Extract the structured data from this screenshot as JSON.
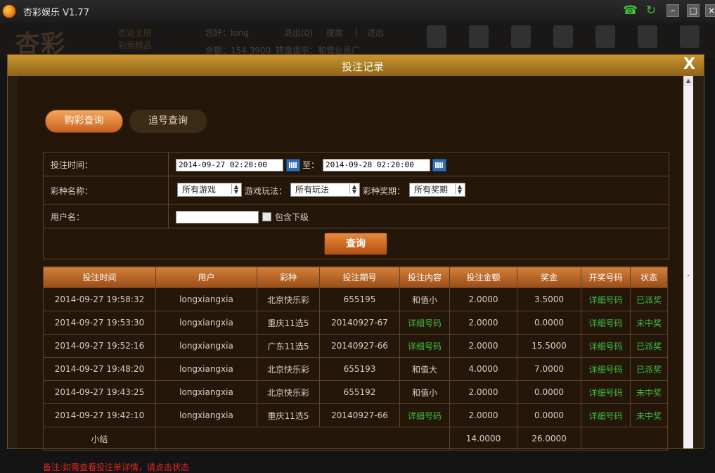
{
  "app": {
    "title": "杏彩娱乐 V1.77",
    "background_header": {
      "logo_text": "杏彩",
      "slogan_line1": "杏运无限",
      "slogan_line2": "彩票精品",
      "greeting": "您好：long",
      "links": [
        "退出(0)",
        "提款",
        "|",
        "退出"
      ],
      "balance": "余额：154.3900",
      "notice": "转盘提示：和营业员厂"
    }
  },
  "modal": {
    "title": "投注记录",
    "close_label": "X",
    "tabs": [
      "购彩查询",
      "追号查询"
    ],
    "form": {
      "time_label": "投注时间：",
      "start_time": "2014-09-27 02:20:00",
      "to_label": "至：",
      "end_time": "2014-09-28 02:20:00",
      "lottery_label": "彩种名称：",
      "lottery_value": "所有游戏",
      "play_label": "游戏玩法：",
      "play_value": "所有玩法",
      "period_label": "彩种奖期：",
      "period_value": "所有奖期",
      "user_label": "用户名：",
      "user_value": "",
      "include_sub_label": "包含下级",
      "query_button": "查询"
    },
    "table": {
      "headers": [
        "投注时间",
        "用户",
        "彩种",
        "投注期号",
        "投注内容",
        "投注金额",
        "奖金",
        "开奖号码",
        "状态"
      ],
      "rows": [
        [
          "2014-09-27 19:58:32",
          "longxiangxia",
          "北京快乐彩",
          "655195",
          "和值小",
          "2.0000",
          "3.5000",
          "详细号码",
          "已派奖"
        ],
        [
          "2014-09-27 19:53:30",
          "longxiangxia",
          "重庆11选5",
          "20140927-67",
          "详细号码",
          "2.0000",
          "0.0000",
          "详细号码",
          "未中奖"
        ],
        [
          "2014-09-27 19:52:16",
          "longxiangxia",
          "广东11选5",
          "20140927-66",
          "详细号码",
          "2.0000",
          "15.5000",
          "详细号码",
          "已派奖"
        ],
        [
          "2014-09-27 19:48:20",
          "longxiangxia",
          "北京快乐彩",
          "655193",
          "和值大",
          "4.0000",
          "7.0000",
          "详细号码",
          "已派奖"
        ],
        [
          "2014-09-27 19:43:25",
          "longxiangxia",
          "北京快乐彩",
          "655192",
          "和值小",
          "2.0000",
          "0.0000",
          "详细号码",
          "未中奖"
        ],
        [
          "2014-09-27 19:42:10",
          "longxiangxia",
          "重庆11选5",
          "20140927-66",
          "详细号码",
          "2.0000",
          "0.0000",
          "详细号码",
          "未中奖"
        ]
      ],
      "subtotal_label": "小结",
      "subtotal_amount": "14.0000",
      "subtotal_prize": "26.0000"
    },
    "remark": "备注:如需查看投注单详情，请点击状态"
  },
  "colors": {
    "accent": "#c8621e",
    "link_green": "#3fbf3f",
    "remark_red": "#e8261e"
  }
}
